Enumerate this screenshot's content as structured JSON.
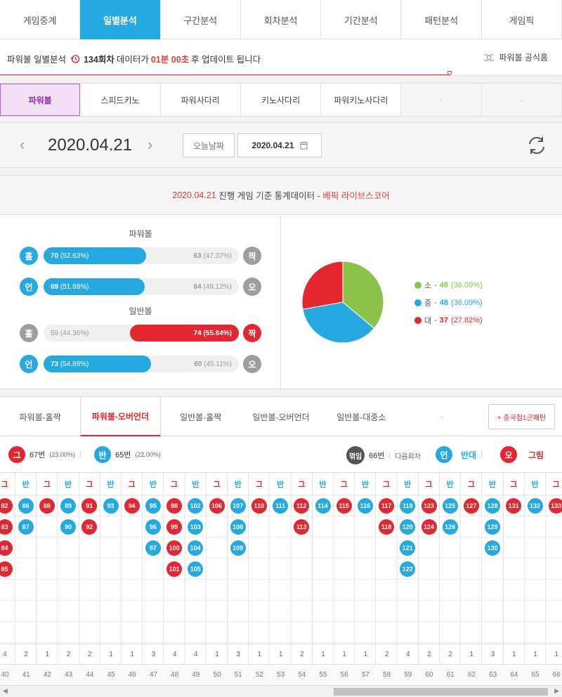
{
  "nav": {
    "tabs": [
      "게임중계",
      "일별분석",
      "구간분석",
      "회차분석",
      "기간분석",
      "패턴분석",
      "게임픽"
    ],
    "active": 1
  },
  "info": {
    "prefix": "파워볼 일별분석",
    "round": "134회차",
    "mid": "데이터가",
    "time": "01분 00초",
    "suffix": "후 업데이트 됩니다",
    "home_link": "파워볼 공식홈"
  },
  "game_tabs": [
    "파워볼",
    "스피드키노",
    "파워사다리",
    "키노사다리",
    "파워키노사다리",
    "-",
    "-"
  ],
  "date": {
    "value": "2020.04.21",
    "today_label": "오늘날짜",
    "picker_value": "2020.04.21"
  },
  "stats": {
    "heading_date": "2020.04.21",
    "heading_text": "진행 게임 기준 통계데이터 -",
    "heading_brand": "베픽 라이브스코어",
    "powerball_title": "파워볼",
    "normal_title": "일반볼",
    "rows": [
      {
        "left_label": "홀",
        "left_val": "70",
        "left_pct": "(52.63%)",
        "right_val": "63",
        "right_pct": "(47.37%)",
        "right_label": "짝",
        "winner": "left",
        "fill": 0.5263,
        "color": "#24a9e1",
        "left_circle": "blue",
        "right_circle": "gray"
      },
      {
        "left_label": "언",
        "left_val": "69",
        "left_pct": "(51.88%)",
        "right_val": "64",
        "right_pct": "(48.12%)",
        "right_label": "오",
        "winner": "left",
        "fill": 0.5188,
        "color": "#24a9e1",
        "left_circle": "blue",
        "right_circle": "gray"
      },
      {
        "left_label": "홀",
        "left_val": "59",
        "left_pct": "(44.36%)",
        "right_val": "74",
        "right_pct": "(55.64%)",
        "right_label": "짝",
        "winner": "right",
        "fill": 0.5564,
        "color": "#e3262f",
        "left_circle": "gray",
        "right_circle": "red"
      },
      {
        "left_label": "언",
        "left_val": "73",
        "left_pct": "(54.89%)",
        "right_val": "60",
        "right_pct": "(45.11%)",
        "right_label": "오",
        "winner": "left",
        "fill": 0.5489,
        "color": "#24a9e1",
        "left_circle": "blue",
        "right_circle": "gray"
      }
    ],
    "pie": [
      {
        "label": "소",
        "value": 48,
        "pct": "(36.09%)",
        "color": "#8bc34a"
      },
      {
        "label": "중",
        "value": 48,
        "pct": "(36.09%)",
        "color": "#24a9e1"
      },
      {
        "label": "대",
        "value": 37,
        "pct": "(27.82%)",
        "color": "#e3262f"
      }
    ]
  },
  "pattern_tabs": [
    "파워볼-홀짝",
    "파워볼-오버언더",
    "일반볼-홀짝",
    "일반볼-오버언더",
    "일반볼-대중소",
    "-"
  ],
  "pattern_button": "+ 중국점1군패턴",
  "summary": {
    "a_icon": "그",
    "a_count": "67번",
    "a_pct": "(23.00%)",
    "b_icon": "반",
    "b_count": "65번",
    "b_pct": "(22.00%)",
    "c_icon": "꺾임",
    "c_count": "66번",
    "next_label": "다음회차",
    "d_icon": "언",
    "d_text": "반대",
    "e_icon": "오",
    "e_text": "그림",
    "sep": "|"
  },
  "grid": {
    "columns": [
      {
        "h": "그",
        "balls": [
          "82",
          "83",
          "84",
          "85"
        ],
        "cnt": "4",
        "num": "40"
      },
      {
        "h": "반",
        "balls": [
          "86",
          "87"
        ],
        "cnt": "2",
        "num": "41"
      },
      {
        "h": "그",
        "balls": [
          "88"
        ],
        "cnt": "1",
        "num": "42"
      },
      {
        "h": "반",
        "balls": [
          "89",
          "90"
        ],
        "cnt": "2",
        "num": "43"
      },
      {
        "h": "그",
        "balls": [
          "91",
          "92"
        ],
        "cnt": "2",
        "num": "44"
      },
      {
        "h": "반",
        "balls": [
          "93"
        ],
        "cnt": "1",
        "num": "45"
      },
      {
        "h": "그",
        "balls": [
          "94"
        ],
        "cnt": "1",
        "num": "46"
      },
      {
        "h": "반",
        "balls": [
          "95",
          "96",
          "97"
        ],
        "cnt": "3",
        "num": "47"
      },
      {
        "h": "그",
        "balls": [
          "98",
          "99",
          "100",
          "101"
        ],
        "cnt": "4",
        "num": "48"
      },
      {
        "h": "반",
        "balls": [
          "102",
          "103",
          "104",
          "105"
        ],
        "cnt": "4",
        "num": "49"
      },
      {
        "h": "그",
        "balls": [
          "106"
        ],
        "cnt": "1",
        "num": "50"
      },
      {
        "h": "반",
        "balls": [
          "107",
          "108",
          "109"
        ],
        "cnt": "3",
        "num": "51"
      },
      {
        "h": "그",
        "balls": [
          "110"
        ],
        "cnt": "1",
        "num": "52"
      },
      {
        "h": "반",
        "balls": [
          "111"
        ],
        "cnt": "1",
        "num": "53"
      },
      {
        "h": "그",
        "balls": [
          "112",
          "113"
        ],
        "cnt": "2",
        "num": "54"
      },
      {
        "h": "반",
        "balls": [
          "114"
        ],
        "cnt": "1",
        "num": "55"
      },
      {
        "h": "그",
        "balls": [
          "115"
        ],
        "cnt": "1",
        "num": "56"
      },
      {
        "h": "반",
        "balls": [
          "116"
        ],
        "cnt": "1",
        "num": "57"
      },
      {
        "h": "그",
        "balls": [
          "117",
          "118"
        ],
        "cnt": "2",
        "num": "58"
      },
      {
        "h": "반",
        "balls": [
          "119",
          "120",
          "121",
          "122"
        ],
        "cnt": "4",
        "num": "59"
      },
      {
        "h": "그",
        "balls": [
          "123",
          "124"
        ],
        "cnt": "2",
        "num": "60"
      },
      {
        "h": "반",
        "balls": [
          "125",
          "126"
        ],
        "cnt": "2",
        "num": "61"
      },
      {
        "h": "그",
        "balls": [
          "127"
        ],
        "cnt": "1",
        "num": "62"
      },
      {
        "h": "반",
        "balls": [
          "128",
          "129",
          "130"
        ],
        "cnt": "3",
        "num": "63"
      },
      {
        "h": "그",
        "balls": [
          "131"
        ],
        "cnt": "1",
        "num": "64"
      },
      {
        "h": "반",
        "balls": [
          "132"
        ],
        "cnt": "1",
        "num": "65"
      },
      {
        "h": "그",
        "balls": [
          "133"
        ],
        "cnt": "1",
        "num": "66"
      }
    ]
  }
}
